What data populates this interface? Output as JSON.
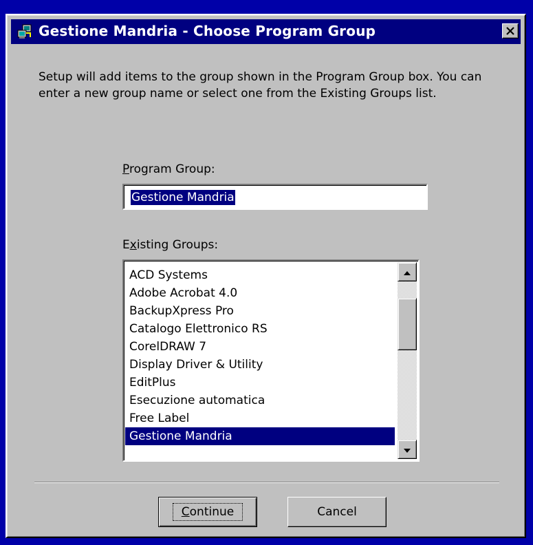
{
  "window": {
    "title": "Gestione Mandria - Choose Program Group",
    "icon": "setup-icon",
    "close_icon": "close-icon"
  },
  "intro_text": "Setup will add items to the group shown in the Program Group box. You can enter a new group name or select one from the Existing Groups list.",
  "program_group": {
    "label_mnemonic": "P",
    "label_rest": "rogram Group:",
    "value": "Gestione Mandria"
  },
  "existing_groups": {
    "label_pre": "E",
    "label_mnemonic": "x",
    "label_rest": "isting Groups:",
    "items": [
      "ACD Systems",
      "Adobe Acrobat 4.0",
      "BackupXpress Pro",
      "Catalogo Elettronico RS",
      "CorelDRAW 7",
      "Display Driver & Utility",
      "EditPlus",
      "Esecuzione automatica",
      "Free Label",
      "Gestione Mandria"
    ],
    "selected": "Gestione Mandria"
  },
  "buttons": {
    "continue_mnemonic": "C",
    "continue_rest": "ontinue",
    "cancel": "Cancel"
  },
  "colors": {
    "desktop": "#0000a8",
    "titlebar": "#000080",
    "face": "#c0c0c0",
    "selection": "#000080"
  }
}
